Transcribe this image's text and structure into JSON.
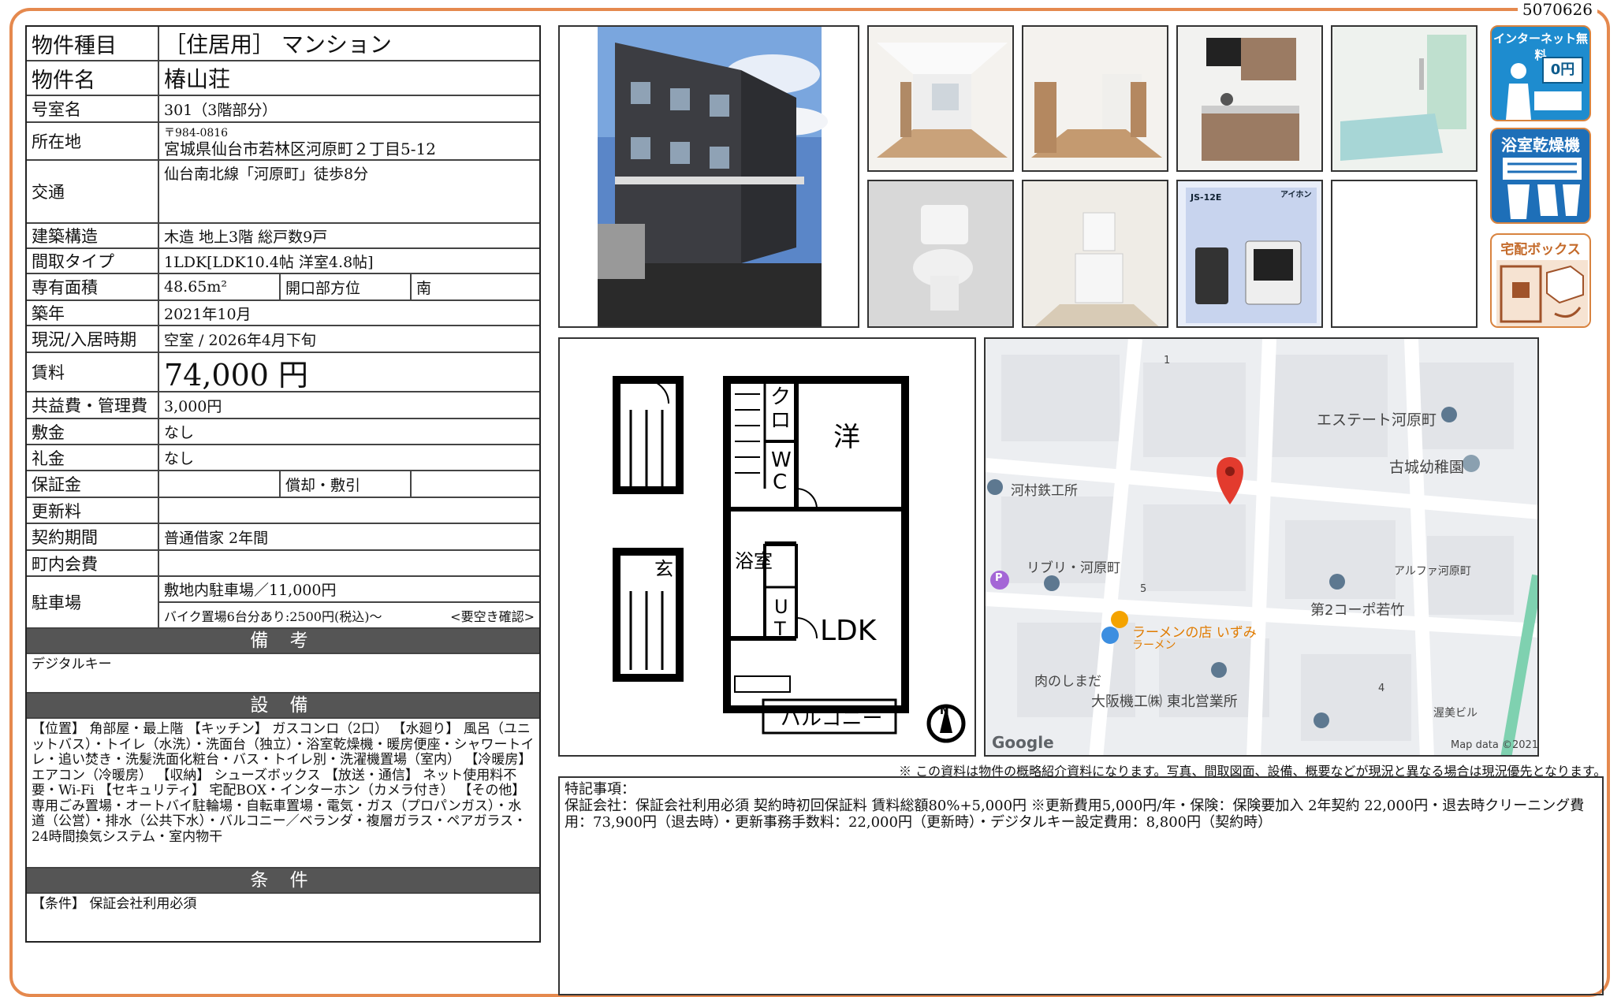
{
  "doc_id": "5070626",
  "table": {
    "type_label": "物件種目",
    "type_value": "［住居用］ マンション",
    "name_label": "物件名",
    "name_value": "椿山荘",
    "room_label": "号室名",
    "room_value": "301（3階部分）",
    "address_label": "所在地",
    "zip": "〒984-0816",
    "address": "宮城県仙台市若林区河原町２丁目5-12",
    "traffic_label": "交通",
    "traffic_value": "仙台南北線「河原町」徒歩8分",
    "structure_label": "建築構造",
    "structure_value": "木造 地上3階 総戸数9戸",
    "layout_label": "間取タイプ",
    "layout_value": "1LDK[LDK10.4帖 洋室4.8帖]",
    "area_label": "専有面積",
    "area_value": "48.65m²",
    "direction_label": "開口部方位",
    "direction_value": "南",
    "built_label": "築年",
    "built_value": "2021年10月",
    "status_label": "現況/入居時期",
    "status_value": "空室 / 2026年4月下旬",
    "rent_label": "賃料",
    "rent_value": "74,000 円",
    "fee_label": "共益費・管理費",
    "fee_value": "3,000円",
    "deposit_label": "敷金",
    "deposit_value": "なし",
    "key_money_label": "礼金",
    "key_money_value": "なし",
    "guarantee_label": "保証金",
    "guarantee_value": "",
    "amort_label": "償却・敷引",
    "amort_value": "",
    "renewal_label": "更新料",
    "renewal_value": "",
    "contract_label": "契約期間",
    "contract_value": "普通借家 2年間",
    "town_label": "町内会費",
    "town_value": "",
    "parking_label": "駐車場",
    "parking_value1": "敷地内駐車場／11,000円",
    "parking_value2": "バイク置場6台分あり:2500円(税込)～",
    "parking_value2b": "<要空き確認>",
    "remarks_head": "備 考",
    "remarks": "デジタルキー",
    "equipment_head": "設 備",
    "equipment": "【位置】 角部屋・最上階 【キッチン】 ガスコンロ（2口） 【水廻り】 風呂（ユニットバス）・トイレ（水洗）・洗面台（独立）・浴室乾燥機・暖房便座・シャワートイレ・追い焚き・洗髪洗面化粧台・バス・トイレ別・洗濯機置場（室内） 【冷暖房】 エアコン（冷暖房） 【収納】 シューズボックス 【放送・通信】 ネット使用料不要・Wi-Fi 【セキュリティ】 宅配BOX・インターホン（カメラ付き） 【その他】 専用ごみ置場・オートバイ駐輪場・自転車置場・電気・ガス（プロパンガス）・水道（公営）・排水（公共下水）・バルコニー／ベランダ・複層ガラス・ペアガラス・24時間換気システム・室内物干",
    "conditions_head": "条 件",
    "conditions": "【条件】 保証会社利用必須"
  },
  "badges": [
    "インターネット無料",
    "0円",
    "浴室乾燥機",
    "宅配ボックス"
  ],
  "intercom": {
    "model": "JS-12E",
    "brand": "アイホン"
  },
  "floorplan": {
    "room1": "洋",
    "cl1": "ク",
    "cl2": "ロ",
    "wc1": "W",
    "wc2": "C",
    "bath": "浴室",
    "ut1": "U",
    "ut2": "T",
    "ldk": "LDK",
    "balcony": "バルコニー",
    "entrance": "玄",
    "north": "N"
  },
  "map": {
    "labels": [
      "エステート河原町",
      "古城幼稚園",
      "河村鉄工所",
      "リブリ・河原町",
      "アルファ河原町",
      "第2コーポ若竹",
      "ラーメンの店 いずみ",
      "ラーメン",
      "肉のしまだ",
      "大阪機工㈱ 東北営業所",
      "渥美ビル",
      "1",
      "5",
      "4",
      "P",
      "Google",
      "Map data ©2021"
    ]
  },
  "disclaimer": "※ この資料は物件の概略紹介資料になります。写真、間取図面、設備、概要などが現況と異なる場合は現況優先となります。",
  "special": {
    "title": "特記事項：",
    "body": "保証会社：保証会社利用必須 契約時初回保証料 賃料総額80%+5,000円 ※更新費用5,000円/年・保険：保険要加入 2年契約 22,000円・退去時クリーニング費用：73,900円（退去時）・更新事務手数料：22,000円（更新時）・デジタルキー設定費用：8,800円（契約時）"
  }
}
